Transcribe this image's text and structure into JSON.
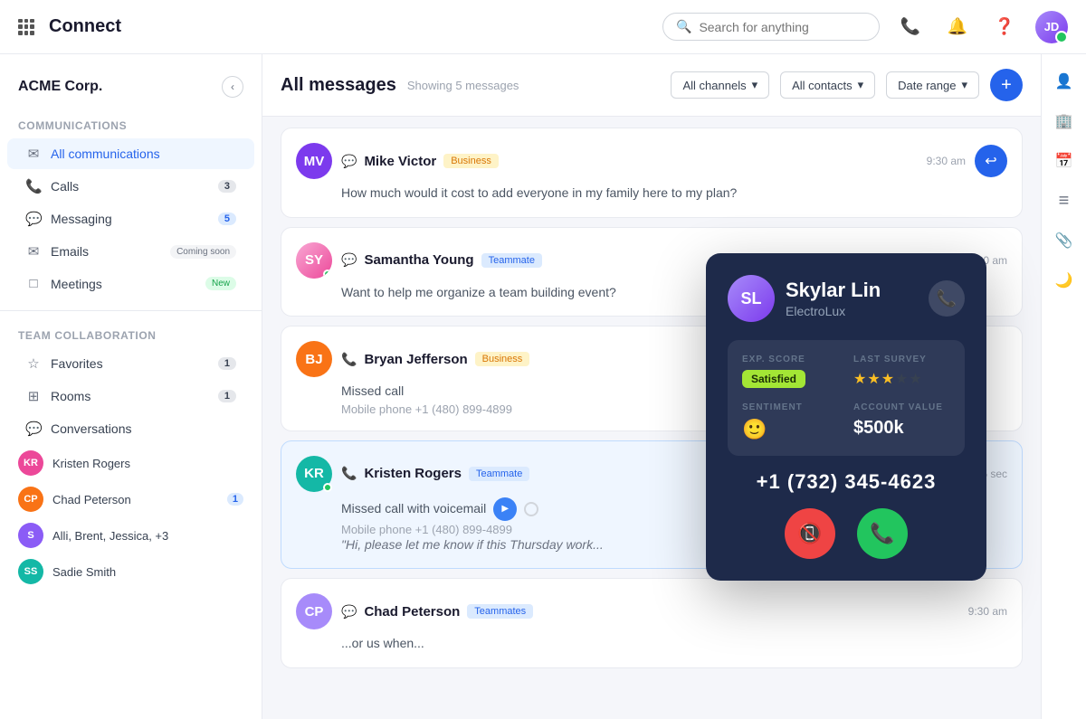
{
  "app": {
    "name": "Connect",
    "search_placeholder": "Search for anything"
  },
  "company": {
    "name": "ACME Corp."
  },
  "sidebar": {
    "communications_title": "Communications",
    "items": [
      {
        "id": "all-comm",
        "label": "All communications",
        "icon": "✉",
        "active": true,
        "badge": null
      },
      {
        "id": "calls",
        "label": "Calls",
        "icon": "📞",
        "active": false,
        "badge": "3"
      },
      {
        "id": "messaging",
        "label": "Messaging",
        "icon": "💬",
        "active": false,
        "badge": "5"
      },
      {
        "id": "emails",
        "label": "Emails",
        "icon": "✉",
        "active": false,
        "badge": null,
        "tag": "Coming soon"
      },
      {
        "id": "meetings",
        "label": "Meetings",
        "icon": "□",
        "active": false,
        "badge": null,
        "tag": "New"
      }
    ],
    "team_title": "Team collaboration",
    "team_items": [
      {
        "id": "favorites",
        "label": "Favorites",
        "icon": "☆",
        "badge": "1"
      },
      {
        "id": "rooms",
        "label": "Rooms",
        "icon": "⊞",
        "badge": "1"
      },
      {
        "id": "conversations",
        "label": "Conversations",
        "icon": "💬",
        "badge": null
      }
    ],
    "conversations": [
      {
        "name": "Kristen Rogers",
        "color": "#ec4899",
        "badge": null
      },
      {
        "name": "Chad Peterson",
        "color": "#f97316",
        "badge": "1"
      },
      {
        "name": "Alli, Brent, Jessica, +3",
        "color": "#8b5cf6",
        "badge": null
      },
      {
        "name": "Sadie Smith",
        "color": "#14b8a6",
        "badge": null
      }
    ]
  },
  "messages": {
    "title": "All messages",
    "count_label": "Showing 5 messages",
    "filters": [
      {
        "label": "All channels",
        "id": "channels-filter"
      },
      {
        "label": "All contacts",
        "id": "contacts-filter"
      },
      {
        "label": "Date range",
        "id": "date-filter"
      }
    ],
    "items": [
      {
        "id": "msg1",
        "name": "Mike Victor",
        "tag": "Business",
        "tag_type": "business",
        "avatar_initials": "MV",
        "avatar_color": "purple",
        "channel": "message",
        "time": "9:30 am",
        "text": "How much would it cost to add everyone in my family here to my plan?",
        "subtext": null,
        "has_reply": true
      },
      {
        "id": "msg2",
        "name": "Samantha Young",
        "tag": "Teammate",
        "tag_type": "teammate",
        "avatar_initials": "SY",
        "avatar_color": "pink",
        "channel": "message",
        "time": "9:30 am",
        "text": "Want to help me organize a team building event?",
        "subtext": null,
        "has_reply": false
      },
      {
        "id": "msg3",
        "name": "Bryan Jefferson",
        "tag": "Business",
        "tag_type": "business",
        "avatar_initials": "BJ",
        "avatar_color": "orange",
        "channel": "call",
        "time": null,
        "text": "Missed call",
        "subtext": "Mobile phone +1 (480) 899-4899",
        "has_reply": false
      },
      {
        "id": "msg4",
        "name": "Kristen Rogers",
        "tag": "Teammate",
        "tag_type": "teammate",
        "avatar_initials": "KR",
        "avatar_color": "teal",
        "channel": "call",
        "time": "15 sec",
        "text": "Missed call with voicemail",
        "subtext": "Mobile phone +1 (480) 899-4899",
        "quote": "\"Hi, please let me know if this Thursday work...",
        "has_reply": false
      },
      {
        "id": "msg5",
        "name": "Chad Peterson",
        "tag": "Teammates",
        "tag_type": "teammates",
        "avatar_initials": "CP",
        "avatar_color": "brown",
        "channel": "message",
        "time": "9:30 am",
        "text": "...or us when...",
        "has_reply": false
      }
    ]
  },
  "call_card": {
    "contact_name": "Skylar Lin",
    "company": "ElectroLux",
    "phone": "+1 (732) 345-4623",
    "exp_score_label": "EXP. SCORE",
    "exp_score_value": "Satisfied",
    "last_survey_label": "LAST SURVEY",
    "stars_filled": 3,
    "stars_total": 5,
    "sentiment_label": "SENTIMENT",
    "sentiment_emoji": "🙂",
    "account_value_label": "ACCOUNT VALUE",
    "account_value": "$500k",
    "decline_label": "Decline",
    "accept_label": "Accept"
  },
  "right_sidebar": {
    "icons": [
      {
        "id": "person-icon",
        "symbol": "👤"
      },
      {
        "id": "building-icon",
        "symbol": "🏢"
      },
      {
        "id": "calendar-icon",
        "symbol": "📅"
      },
      {
        "id": "list-icon",
        "symbol": "≡"
      },
      {
        "id": "paperclip-icon",
        "symbol": "📎"
      },
      {
        "id": "moon-icon",
        "symbol": "🌙"
      }
    ]
  }
}
